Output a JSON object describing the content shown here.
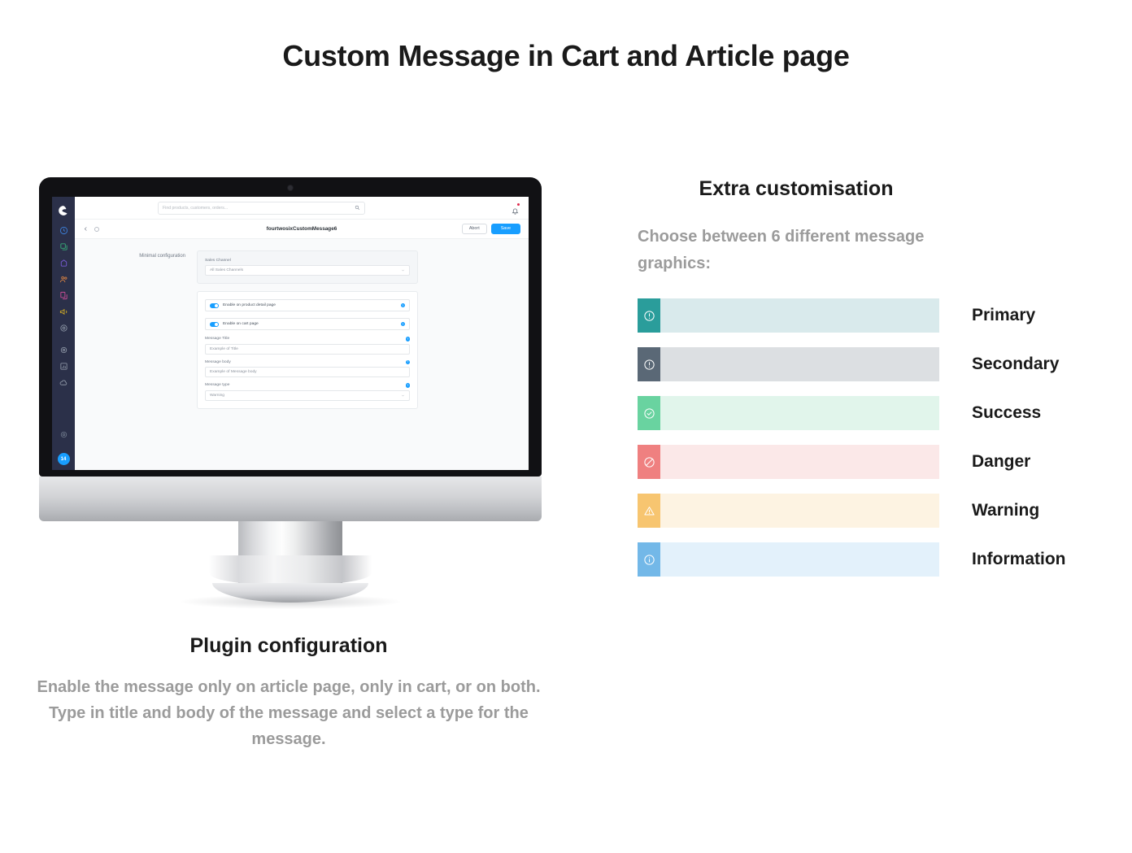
{
  "page": {
    "title": "Custom Message in Cart and Article page"
  },
  "left_section": {
    "caption_title": "Plugin configuration",
    "caption_body": "Enable the message only on article page, only in cart, or on both. Type in title and body of the message and select a type for the message.",
    "screen": {
      "search_placeholder": "Find products, customers, orders...",
      "breadcrumb_title": "fourtwosixCustomMessage6",
      "abort_label": "Abort",
      "save_label": "Save",
      "section_label": "Minimal configuration",
      "sales_channel_label": "Sales Channel",
      "sales_channel_value": "All Sales Channels",
      "toggle_product_page": "Enable on product detail page",
      "toggle_cart_page": "Enable on cart page",
      "message_title_label": "Message Title",
      "message_title_value": "Example of Title",
      "message_body_label": "Message body",
      "message_body_value": "Example of Message body",
      "message_type_label": "Message type",
      "message_type_value": "Warning",
      "help_marker": "?",
      "avatar_initials": "14",
      "sidebar_icons": [
        {
          "name": "dashboard-icon",
          "color": "#3d83df"
        },
        {
          "name": "catalogues-icon",
          "color": "#37b17a"
        },
        {
          "name": "orders-icon",
          "color": "#7b5ddb"
        },
        {
          "name": "customers-icon",
          "color": "#d98243"
        },
        {
          "name": "content-icon",
          "color": "#d14f9a"
        },
        {
          "name": "marketing-icon",
          "color": "#d8b024"
        },
        {
          "name": "extensions-icon",
          "color": "#8e97a6"
        },
        {
          "name": "settings-gear-icon",
          "color": "#8e97a6"
        },
        {
          "name": "reports-icon",
          "color": "#8e97a6"
        },
        {
          "name": "cloud-icon",
          "color": "#8e97a6"
        }
      ]
    }
  },
  "right_section": {
    "title": "Extra customisation",
    "subtitle": "Choose between 6 different message graphics:",
    "message_types": [
      {
        "label": "Primary",
        "icon": "exclamation-circle-icon",
        "icon_bg": "#2a9d9b",
        "body_bg": "#d9eaec",
        "icon_color": "#ffffff"
      },
      {
        "label": "Secondary",
        "icon": "exclamation-circle-icon",
        "icon_bg": "#5a6876",
        "body_bg": "#dcdfe2",
        "icon_color": "#ffffff"
      },
      {
        "label": "Success",
        "icon": "check-circle-icon",
        "icon_bg": "#69d3a0",
        "body_bg": "#e1f5eb",
        "icon_color": "#ffffff"
      },
      {
        "label": "Danger",
        "icon": "ban-circle-icon",
        "icon_bg": "#ef8080",
        "body_bg": "#fbe8e8",
        "icon_color": "#ffffff"
      },
      {
        "label": "Warning",
        "icon": "warning-triangle-icon",
        "icon_bg": "#f7c570",
        "body_bg": "#fdf3e2",
        "icon_color": "#ffffff"
      },
      {
        "label": "Information",
        "icon": "info-circle-icon",
        "icon_bg": "#73b8e8",
        "body_bg": "#e3f1fb",
        "icon_color": "#ffffff"
      }
    ]
  }
}
